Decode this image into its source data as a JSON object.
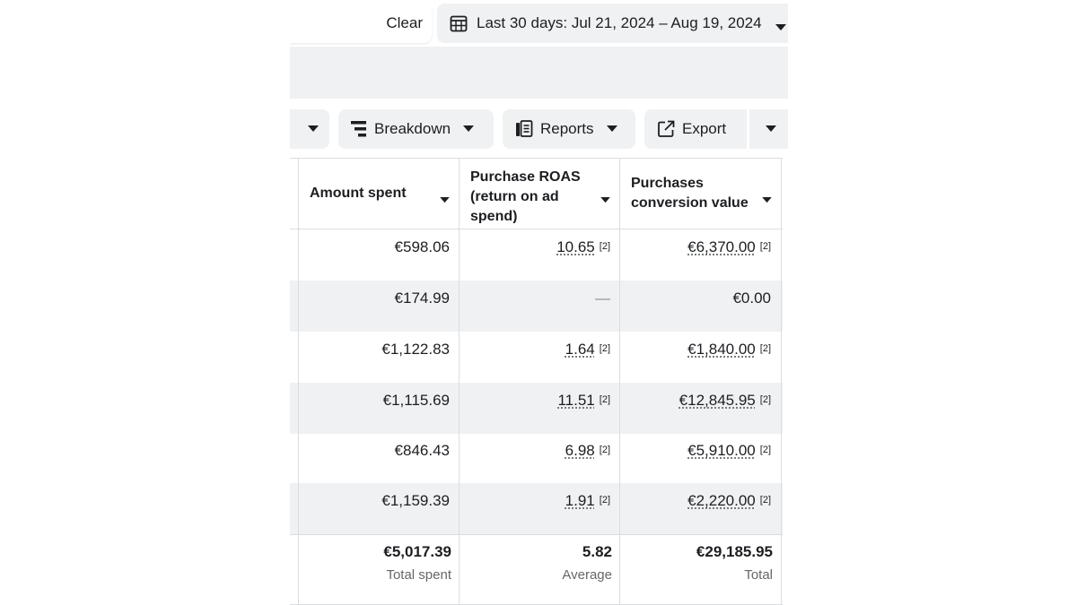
{
  "search": {
    "clear_label": "Clear"
  },
  "date_range": {
    "label": "Last 30 days: Jul 21, 2024 – Aug 19, 2024"
  },
  "toolbar": {
    "breakdown_label": "Breakdown",
    "reports_label": "Reports",
    "export_label": "Export"
  },
  "icons": {
    "calendar": "calendar-icon",
    "breakdown": "breakdown-icon",
    "reports": "reports-icon",
    "export": "export-icon",
    "caret": "caret-down-icon"
  },
  "colors": {
    "button_bg": "#f0f1f3",
    "border": "#dadde1",
    "muted_text": "#65676b",
    "text": "#1c1e21"
  },
  "table": {
    "columns": [
      {
        "label": "Amount spent"
      },
      {
        "label": "Purchase ROAS (return on ad spend)"
      },
      {
        "label": "Purchases conversion value"
      }
    ],
    "rows": [
      {
        "amount": "€598.06",
        "roas": "10.65",
        "roas_note": "[2]",
        "value": "€6,370.00",
        "value_note": "[2]"
      },
      {
        "amount": "€174.99",
        "roas": "—",
        "roas_note": "",
        "value": "€0.00",
        "value_note": ""
      },
      {
        "amount": "€1,122.83",
        "roas": "1.64",
        "roas_note": "[2]",
        "value": "€1,840.00",
        "value_note": "[2]"
      },
      {
        "amount": "€1,115.69",
        "roas": "11.51",
        "roas_note": "[2]",
        "value": "€12,845.95",
        "value_note": "[2]"
      },
      {
        "amount": "€846.43",
        "roas": "6.98",
        "roas_note": "[2]",
        "value": "€5,910.00",
        "value_note": "[2]"
      },
      {
        "amount": "€1,159.39",
        "roas": "1.91",
        "roas_note": "[2]",
        "value": "€2,220.00",
        "value_note": "[2]"
      }
    ],
    "totals": {
      "amount": "€5,017.39",
      "amount_label": "Total spent",
      "roas": "5.82",
      "roas_label": "Average",
      "value": "€29,185.95",
      "value_label": "Total"
    }
  }
}
